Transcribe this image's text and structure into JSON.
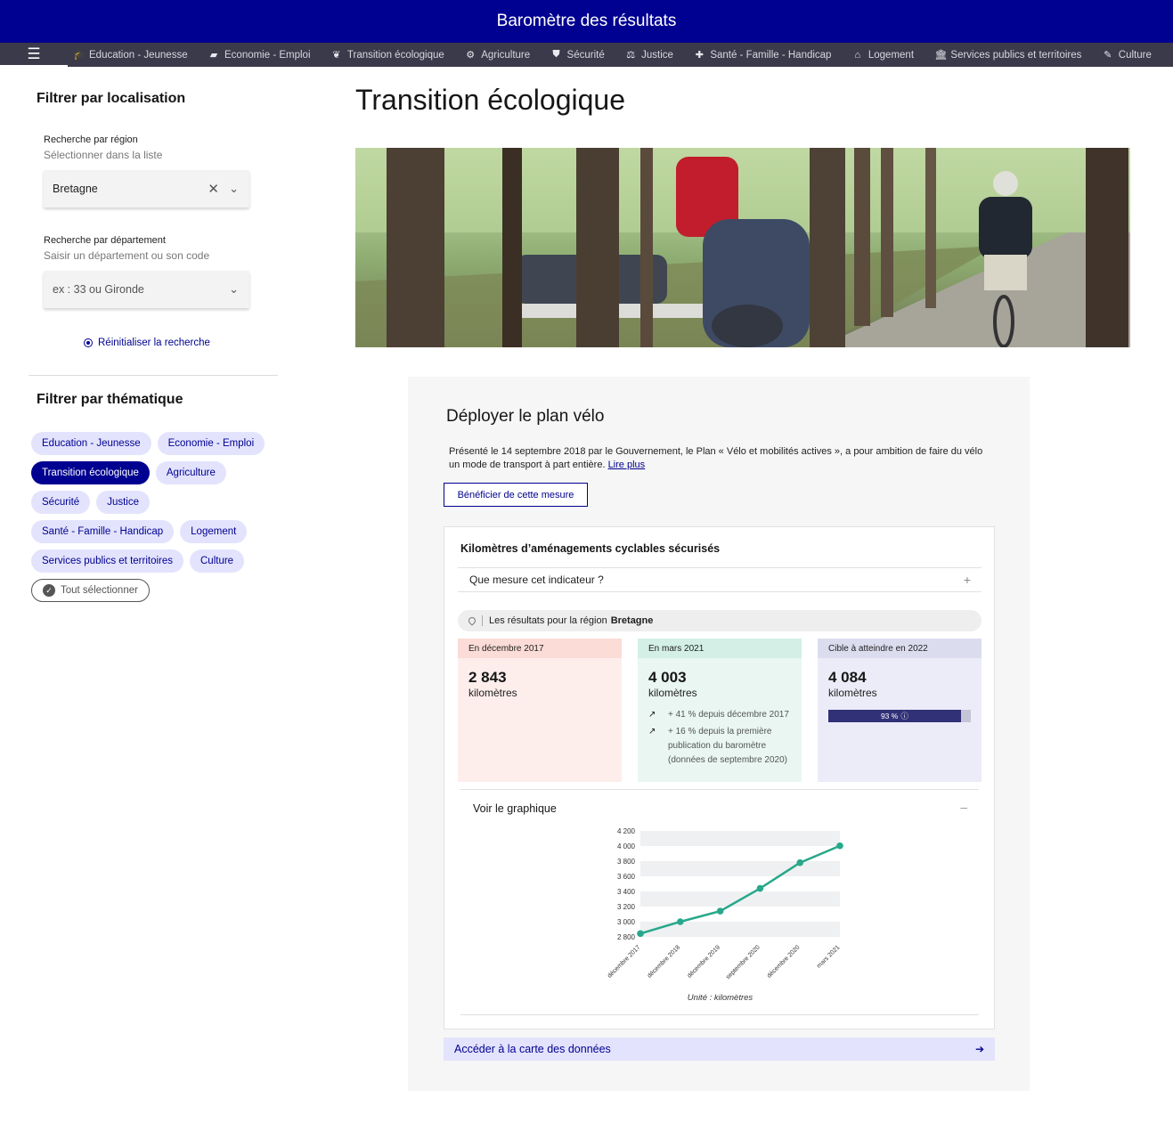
{
  "header": {
    "title": "Baromètre des résultats"
  },
  "nav": {
    "menu_icon": "menu-icon",
    "items": [
      {
        "label": "Education - Jeunesse",
        "icon": "graduation-cap-icon",
        "glyph": "🎓"
      },
      {
        "label": "Economie - Emploi",
        "icon": "briefcase-icon",
        "glyph": "▰"
      },
      {
        "label": "Transition écologique",
        "icon": "leaf-icon",
        "glyph": "❦"
      },
      {
        "label": "Agriculture",
        "icon": "tractor-icon",
        "glyph": "⚙"
      },
      {
        "label": "Sécurité",
        "icon": "shield-icon",
        "glyph": "⛊"
      },
      {
        "label": "Justice",
        "icon": "scales-icon",
        "glyph": "⚖"
      },
      {
        "label": "Santé - Famille - Handicap",
        "icon": "medical-kit-icon",
        "glyph": "✚"
      },
      {
        "label": "Logement",
        "icon": "home-icon",
        "glyph": "⌂"
      },
      {
        "label": "Services publics et territoires",
        "icon": "government-building-icon",
        "glyph": "🏛"
      },
      {
        "label": "Culture",
        "icon": "brush-icon",
        "glyph": "✎"
      }
    ]
  },
  "sidebar": {
    "location_heading": "Filtrer par localisation",
    "region": {
      "label": "Recherche par région",
      "hint": "Sélectionner dans la liste",
      "value": "Bretagne"
    },
    "department": {
      "label": "Recherche par département",
      "hint": "Saisir un département ou son code",
      "placeholder": "ex : 33 ou Gironde"
    },
    "reset_label": "Réinitialiser la recherche",
    "theme_heading": "Filtrer par thématique",
    "tags": [
      [
        "Education - Jeunesse",
        "Economie - Emploi"
      ],
      [
        "Transition écologique",
        "Agriculture"
      ],
      [
        "Sécurité",
        "Justice"
      ],
      [
        "Santé - Famille - Handicap",
        "Logement"
      ],
      [
        "Services publics et territoires",
        "Culture"
      ]
    ],
    "active_tag": "Transition écologique",
    "select_all": "Tout sélectionner"
  },
  "main": {
    "title": "Transition écologique",
    "measure": {
      "title": "Déployer le plan vélo",
      "description": "Présenté le 14 septembre 2018 par le Gouvernement, le Plan « Vélo et mobilités actives », a pour ambition de faire du vélo un mode de transport à part entière.",
      "read_more": "Lire plus",
      "button": "Bénéficier de cette mesure",
      "indicator": {
        "title": "Kilomètres d’aménagements cyclables sécurisés",
        "accordion": "Que mesure cet indicateur ?",
        "region_prefix": "Les résultats pour la région",
        "region_name": "Bretagne",
        "initial": {
          "label": "En décembre 2017",
          "value": "2 843",
          "unit": "kilomètres",
          "color": "#fdeeec"
        },
        "current": {
          "label": "En mars 2021",
          "value": "4 003",
          "unit": "kilomètres",
          "color": "#e9f6f2",
          "evolution_1": "+ 41 % depuis décembre 2017",
          "evolution_2": "+ 16 % depuis la première publication du baromètre (données de septembre 2020)"
        },
        "target": {
          "label": "Cible à atteindre en 2022",
          "value": "4 084",
          "unit": "kilomètres",
          "color": "#ececf8",
          "progress_label": "93 %",
          "progress": 0.93
        },
        "graph_toggle": "Voir le graphique",
        "chart_unit": "Unité : kilomètres"
      },
      "map_link": "Accéder à la carte des données"
    }
  },
  "chart_data": {
    "type": "line",
    "categories": [
      "décembre 2017",
      "décembre 2018",
      "décembre 2019",
      "septembre 2020",
      "décembre 2020",
      "mars 2021"
    ],
    "series": [
      {
        "values": [
          2843,
          3000,
          3140,
          3440,
          3780,
          4003
        ]
      }
    ],
    "y_ticks": [
      "2 800",
      "3 000",
      "3 200",
      "3 400",
      "3 600",
      "3 800",
      "4 000",
      "4 200"
    ],
    "ylim": [
      2800,
      4200
    ],
    "line_color": "#27a88a",
    "xlabel": "",
    "ylabel": "",
    "unit_label": "Unité : kilomètres",
    "grid": "alternating bands"
  }
}
